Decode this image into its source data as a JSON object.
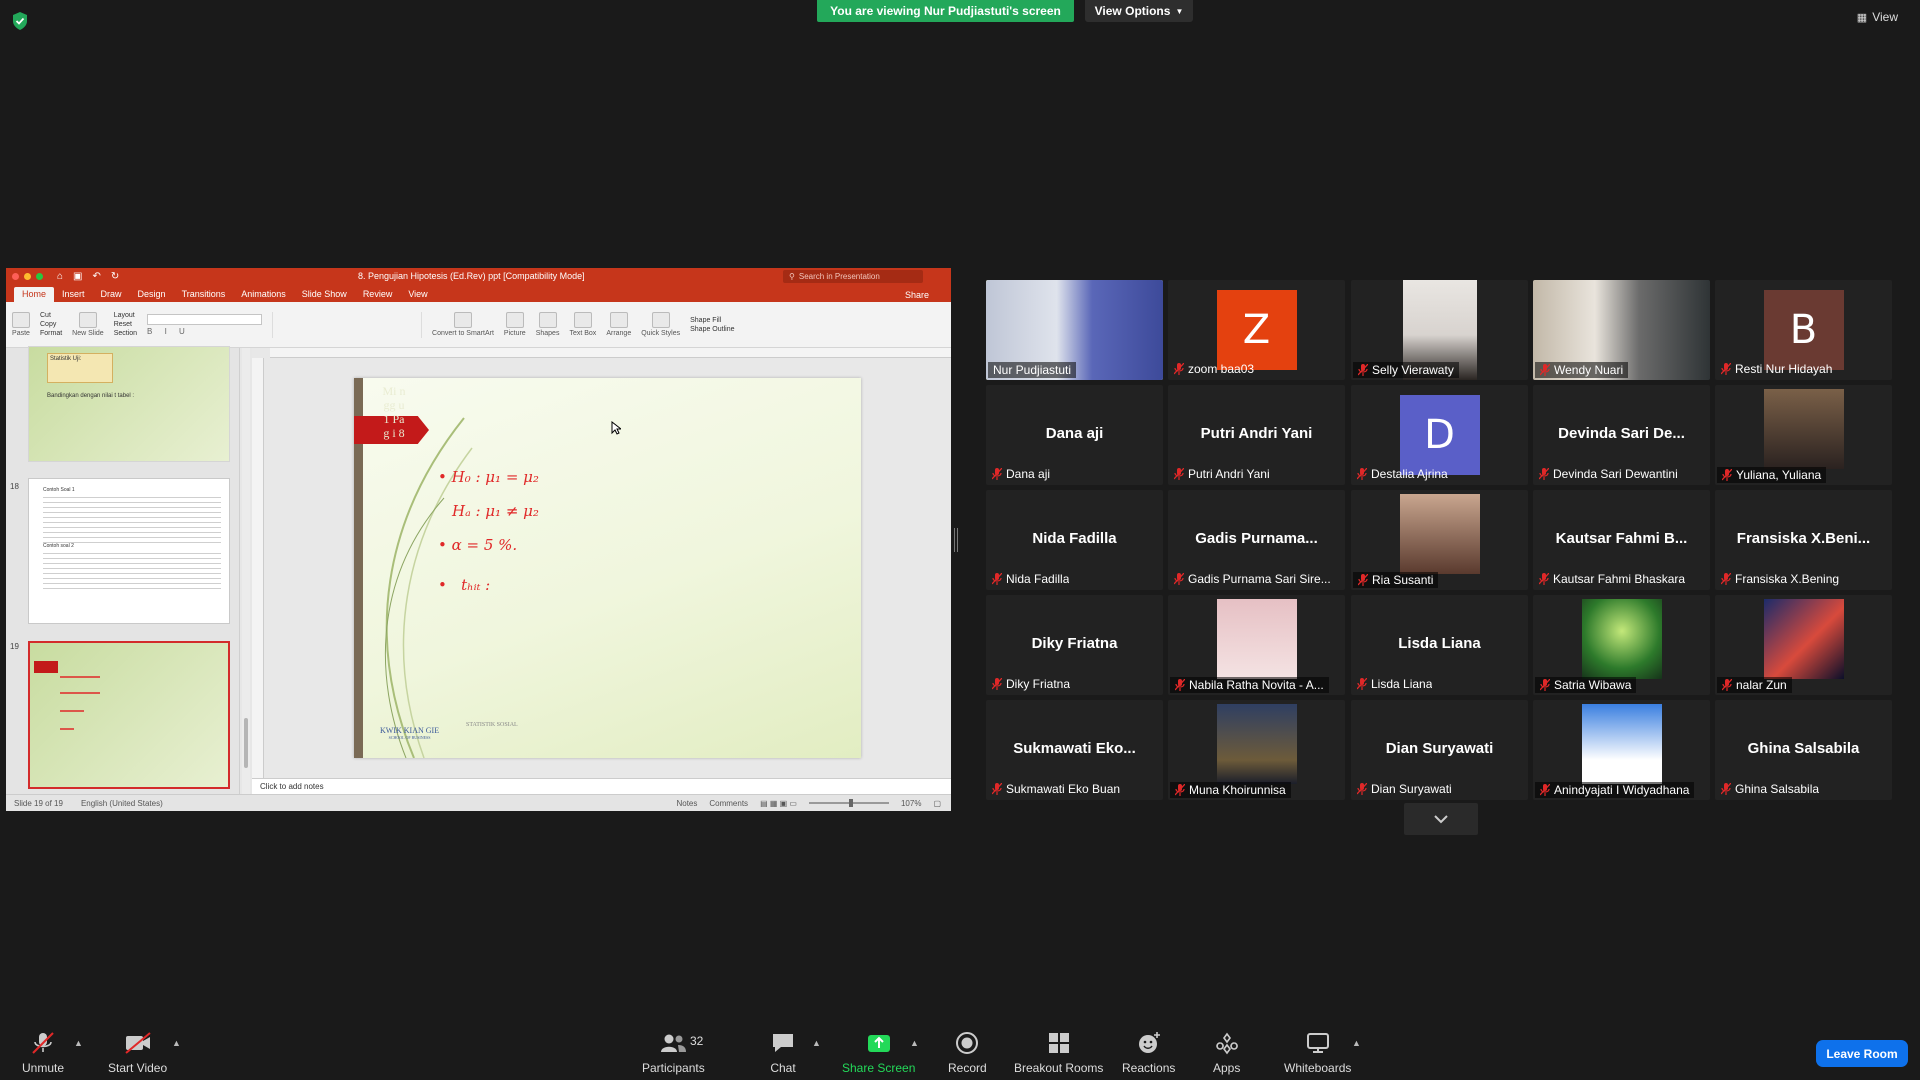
{
  "top": {
    "viewing_banner": "You are viewing Nur Pudjiastuti's screen",
    "view_options": "View Options",
    "view_button": "View"
  },
  "ppt": {
    "document_title": "8. Pengujian Hipotesis (Ed.Rev) ppt [Compatibility Mode]",
    "search_placeholder": "Search in Presentation",
    "tabs": [
      "Home",
      "Insert",
      "Draw",
      "Design",
      "Transitions",
      "Animations",
      "Slide Show",
      "Review",
      "View"
    ],
    "share_label": "Share",
    "ribbon": {
      "paste": "Paste",
      "cut": "Cut",
      "copy": "Copy",
      "format": "Format",
      "new_slide": "New Slide",
      "layout": "Layout",
      "reset": "Reset",
      "section": "Section",
      "convert": "Convert to SmartArt",
      "picture": "Picture",
      "shapes": "Shapes",
      "text_box": "Text Box",
      "arrange": "Arrange",
      "quick_styles": "Quick Styles",
      "shape_fill": "Shape Fill",
      "shape_outline": "Shape Outline"
    },
    "thumbnails": {
      "slide17_line1": "Statistik Uji:",
      "slide17_line2": "Bandingkan dengan nilai t tabel : ",
      "slide18_num": "18",
      "slide18_title": "Contoh Soal 1",
      "slide18_title2": "Contoh soal 2",
      "slide19_num": "19"
    },
    "slide": {
      "side_label": "Mi ngg u 1 Pag i 8",
      "footer_center": "STATISTIK SOSIAL",
      "logo_text": "KWIK KIAN GIE",
      "logo_sub": "SCHOOL OF BUSINESS",
      "ink": {
        "h0": "H₀ : μ₁ = μ₂",
        "ha": "Hₐ : μ₁ ≠ μ₂",
        "alpha": "α = 5 %.",
        "thit": "tₕᵢₜ :"
      }
    },
    "notes_placeholder": "Click to add notes",
    "status": {
      "slide_of": "Slide 19 of 19",
      "language": "English (United States)",
      "notes": "Notes",
      "comments": "Comments",
      "zoom": "107%"
    }
  },
  "gallery": [
    {
      "name": "Nur Pudjiastuti",
      "type": "video",
      "speaking": true,
      "muted": false
    },
    {
      "name": "zoom baa03",
      "type": "letter",
      "letter": "Z",
      "color": "#e4410f",
      "muted": true
    },
    {
      "name": "Selly Vierawaty",
      "type": "video",
      "muted": true
    },
    {
      "name": "Wendy Nuari",
      "type": "video",
      "muted": true
    },
    {
      "name": "Resti Nur Hidayah",
      "type": "letter",
      "letter": "B",
      "color": "#6a3a32",
      "muted": true
    },
    {
      "name": "Dana aji",
      "type": "name",
      "display": "Dana aji",
      "muted": true
    },
    {
      "name": "Putri Andri Yani",
      "type": "name",
      "display": "Putri Andri Yani",
      "muted": true
    },
    {
      "name": "Destalia Ajrina",
      "type": "letter",
      "letter": "D",
      "color": "#5a5fc8",
      "muted": true
    },
    {
      "name": "Devinda Sari Dewantini",
      "type": "name",
      "display": "Devinda Sari De...",
      "muted": true
    },
    {
      "name": "Yuliana, Yuliana",
      "type": "photo",
      "muted": true
    },
    {
      "name": "Nida Fadilla",
      "type": "name",
      "display": "Nida Fadilla",
      "muted": true
    },
    {
      "name": "Gadis Purnama Sari Sire...",
      "type": "name",
      "display": "Gadis  Purnama...",
      "muted": true
    },
    {
      "name": "Ria Susanti",
      "type": "photo",
      "muted": true
    },
    {
      "name": "Kautsar Fahmi Bhaskara",
      "type": "name",
      "display": "Kautsar Fahmi B...",
      "muted": true
    },
    {
      "name": "Fransiska X.Bening",
      "type": "name",
      "display": "Fransiska X.Beni...",
      "muted": true
    },
    {
      "name": "Diky Friatna",
      "type": "name",
      "display": "Diky Friatna",
      "muted": true
    },
    {
      "name": "Nabila Ratha Novita - A...",
      "type": "photo",
      "muted": true
    },
    {
      "name": "Lisda Liana",
      "type": "name",
      "display": "Lisda Liana",
      "muted": true
    },
    {
      "name": "Satria Wibawa",
      "type": "photo",
      "muted": true
    },
    {
      "name": "nalar Zun",
      "type": "photo",
      "muted": true
    },
    {
      "name": "Sukmawati Eko Buan",
      "type": "name",
      "display": "Sukmawati  Eko...",
      "muted": true
    },
    {
      "name": "Muna Khoirunnisa",
      "type": "photo",
      "muted": true
    },
    {
      "name": "Dian Suryawati",
      "type": "name",
      "display": "Dian Suryawati",
      "muted": true
    },
    {
      "name": "Anindyajati I Widyadhana",
      "type": "photo",
      "muted": true
    },
    {
      "name": "Ghina Salsabila",
      "type": "name",
      "display": "Ghina Salsabila",
      "muted": true
    }
  ],
  "toolbar": {
    "unmute": "Unmute",
    "start_video": "Start Video",
    "participants": "Participants",
    "participants_count": "32",
    "chat": "Chat",
    "share_screen": "Share Screen",
    "record": "Record",
    "breakout": "Breakout Rooms",
    "reactions": "Reactions",
    "apps": "Apps",
    "whiteboards": "Whiteboards",
    "leave": "Leave Room"
  },
  "colors": {
    "banner_green": "#23a85a",
    "ppt_red": "#c6361b",
    "speaker_outline": "#dfe35e",
    "leave_blue": "#0e71eb",
    "share_green": "#23d959",
    "muted_red": "#e02828"
  }
}
